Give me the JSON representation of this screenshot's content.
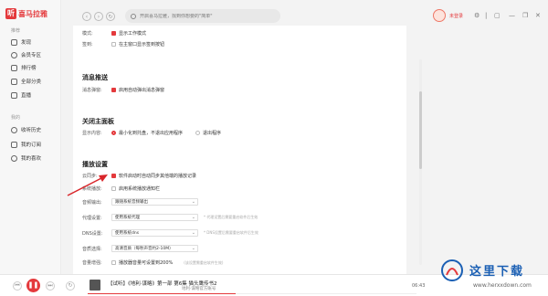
{
  "app": {
    "logo_char": "听",
    "logo_text": "喜马拉雅"
  },
  "sidebar": {
    "section1": "推荐",
    "items1": [
      {
        "label": "发现",
        "icon": "home-icon"
      },
      {
        "label": "会员专区",
        "icon": "vip-icon"
      },
      {
        "label": "排行榜",
        "icon": "rank-icon"
      },
      {
        "label": "全部分类",
        "icon": "grid-icon"
      },
      {
        "label": "直播",
        "icon": "live-icon"
      }
    ],
    "section2": "我的",
    "items2": [
      {
        "label": "收听历史",
        "icon": "history-icon"
      },
      {
        "label": "我的订阅",
        "icon": "subscribe-icon"
      },
      {
        "label": "我的喜欢",
        "icon": "heart-icon"
      }
    ]
  },
  "topbar": {
    "search_placeholder": "开启喜马拉雅，找到你想要的\"简单\"",
    "login_label": "未登录",
    "window_controls": [
      "minimize-icon",
      "maximize-icon",
      "close-icon"
    ]
  },
  "settings": {
    "mode_label": "模式:",
    "mode_option": "显示工作模式",
    "signin_label": "签到:",
    "signin_option": "在主窗口显示签到按钮",
    "push_title": "消息推送",
    "push_label": "消息弹窗:",
    "push_option": "启用自动弹出消息弹窗",
    "close_title": "关闭主面板",
    "close_label": "显示内容:",
    "close_options": [
      "最小化到托盘，不退出应用程序",
      "退出程序"
    ],
    "play_title": "播放设置",
    "cloud_label": "云同步:",
    "cloud_option": "软件启动时自动同步其他端的播放记录",
    "system_label": "系统播放:",
    "system_option": "启用系统播放通知栏",
    "audio_label": "音频输出:",
    "audio_value": "跟随系统音频输出",
    "proxy_label": "代理设置:",
    "proxy_value": "使用系统代理",
    "proxy_hint": "* 代理设置后需要重启软件后生效",
    "dns_label": "DNS设置:",
    "dns_value": "使用系统dns",
    "dns_hint": "* DNS设置后需要重启软件后生效",
    "quality_label": "音质选择:",
    "quality_value": "高清音质（每秒声音约2-10M）",
    "boost_label": "音量增强:",
    "boost_option": "播放器音量可设置到200%",
    "boost_hint": "(该设置需重启软件生效)"
  },
  "player": {
    "title": "【试听】《地利·谋略》第一部 第6集 猫头鹰传书2",
    "subtitle": "地利·谋略官方账号",
    "time": "06:43",
    "progress": 0.45
  },
  "watermark": {
    "text": "这里下载",
    "url": "www.herxxdown.com"
  },
  "colors": {
    "accent": "#e4393c",
    "watermark": "#1a5fb4"
  }
}
